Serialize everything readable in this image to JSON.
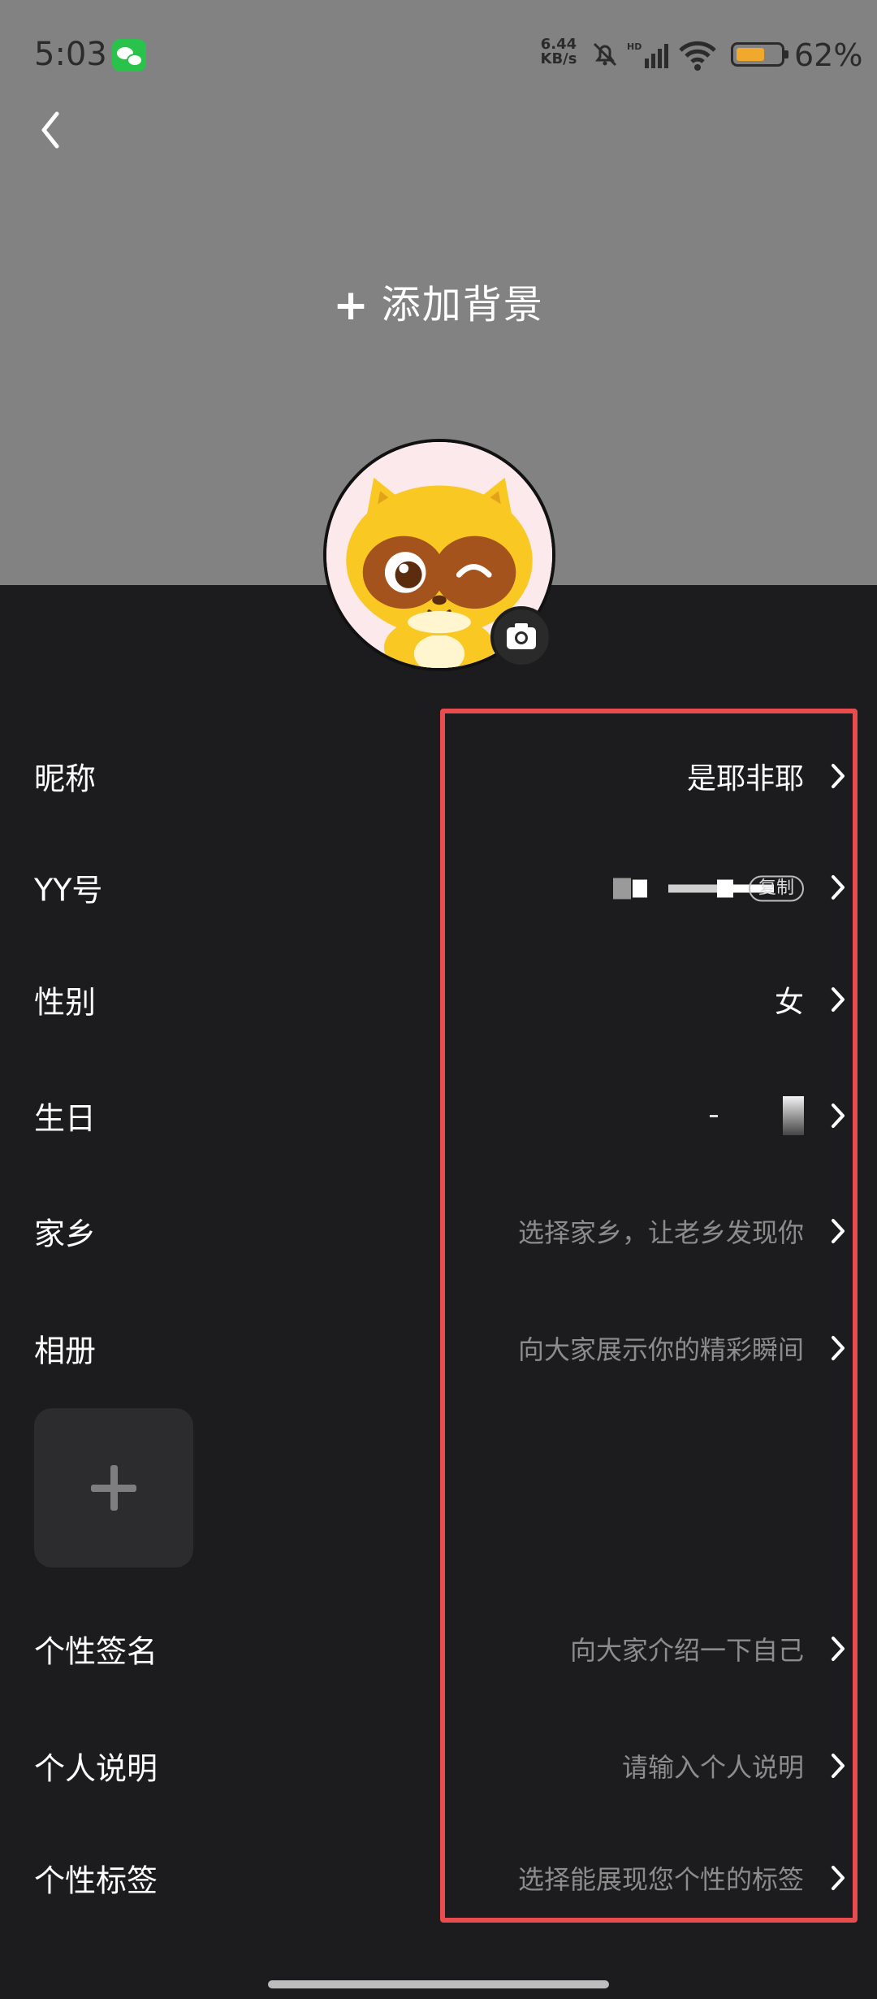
{
  "status_bar": {
    "time": "5:03",
    "net_speed_value": "6.44",
    "net_speed_unit": "KB/s",
    "signal_label": "HD",
    "battery_percent": 62,
    "battery_text": "62%"
  },
  "header": {
    "add_background_label": "添加背景"
  },
  "profile": {
    "rows": [
      {
        "label": "昵称",
        "value": "是耶非耶"
      },
      {
        "label": "YY号",
        "value": "",
        "badge": "复制"
      },
      {
        "label": "性别",
        "value": "女"
      },
      {
        "label": "生日",
        "value": ""
      },
      {
        "label": "家乡",
        "value": "选择家乡，让老乡发现你"
      },
      {
        "label": "相册",
        "value": "向大家展示你的精彩瞬间"
      },
      {
        "label": "个性签名",
        "value": "向大家介绍一下自己"
      },
      {
        "label": "个人说明",
        "value": "请输入个人说明"
      },
      {
        "label": "个性标签",
        "value": "选择能展现您个性的标签"
      }
    ]
  },
  "colors": {
    "header_bg": "#828282",
    "page_bg": "#1c1c1e",
    "highlight": "#e84c4f",
    "battery_fill": "#f0a92c"
  }
}
